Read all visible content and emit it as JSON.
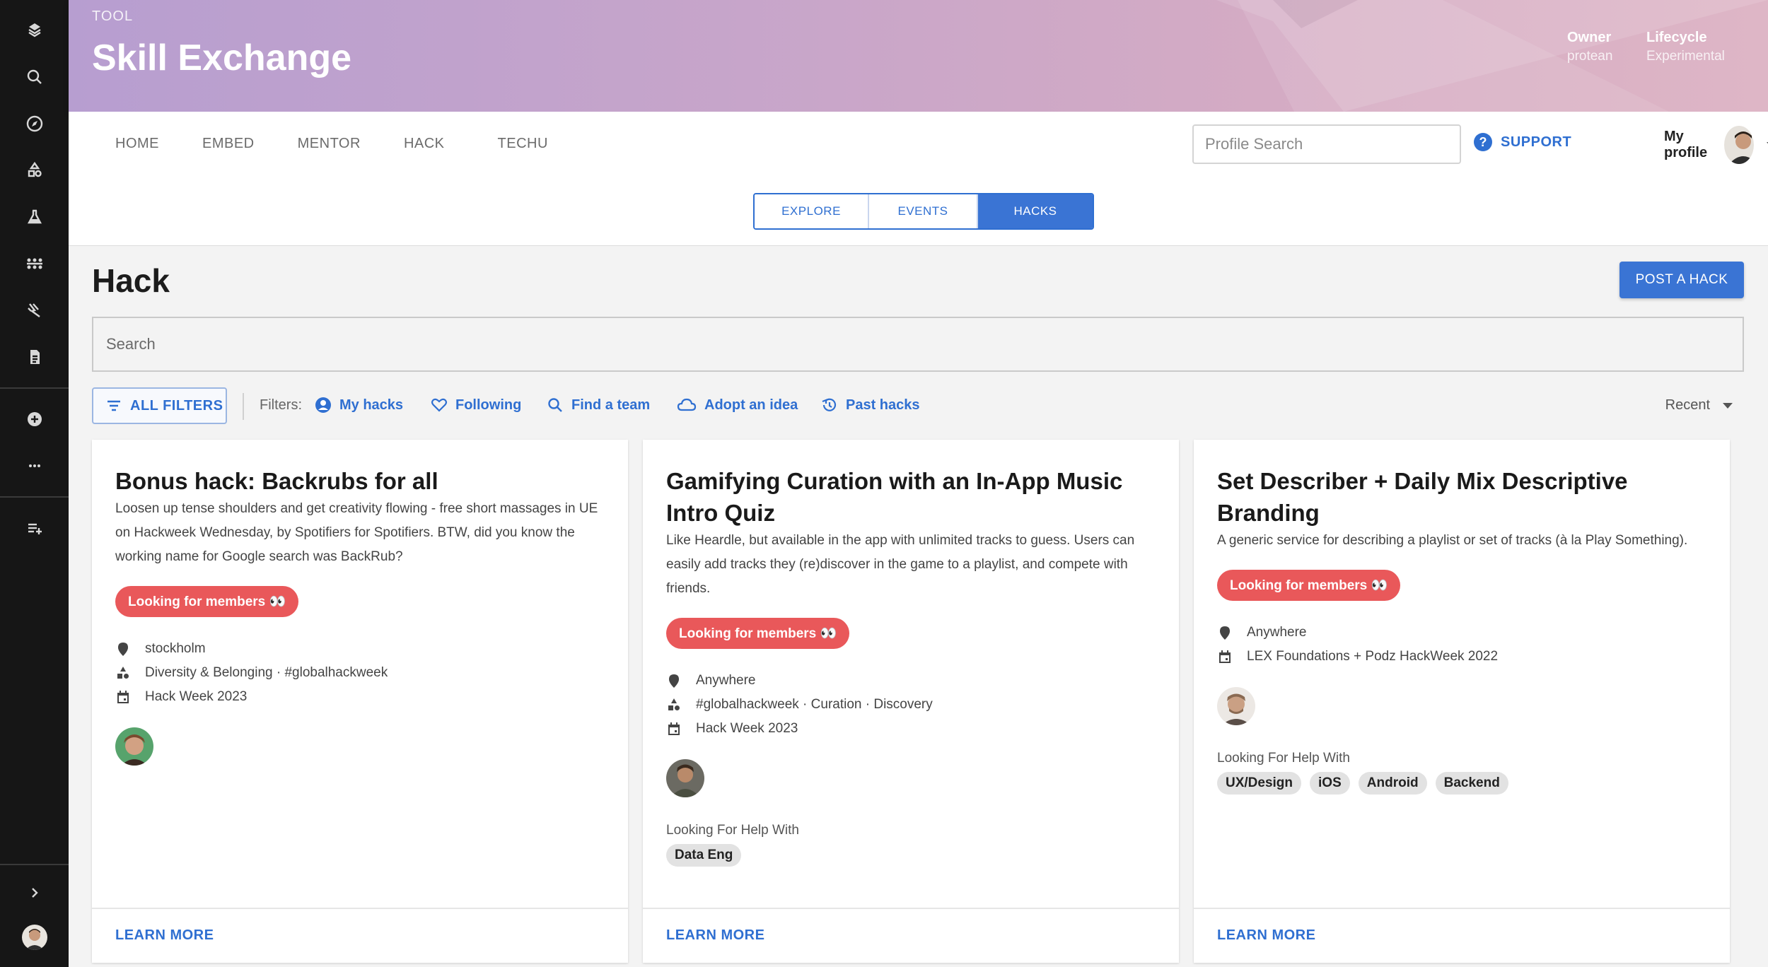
{
  "banner": {
    "kicker": "TOOL",
    "title": "Skill Exchange",
    "owner_label": "Owner",
    "owner_value": "protean",
    "lifecycle_label": "Lifecycle",
    "lifecycle_value": "Experimental"
  },
  "nav": {
    "links": [
      "HOME",
      "EMBED",
      "MENTOR",
      "HACK",
      "TECHU"
    ],
    "profile_search_placeholder": "Profile Search",
    "support_label": "SUPPORT",
    "my_profile_label": "My profile"
  },
  "tabs": [
    "EXPLORE",
    "EVENTS",
    "HACKS"
  ],
  "active_tab": "HACKS",
  "page": {
    "title": "Hack",
    "post_button": "POST A HACK",
    "search_placeholder": "Search"
  },
  "filters": {
    "all_filters_label": "ALL FILTERS",
    "label": "Filters:",
    "chips": [
      "My hacks",
      "Following",
      "Find a team",
      "Adopt an idea",
      "Past hacks"
    ],
    "sort_label": "Recent"
  },
  "cards": [
    {
      "title": "Bonus hack: Backrubs for all",
      "description": "Loosen up tense shoulders and get creativity flowing - free short massages in UE on Hackweek Wednesday, by Spotifiers for Spotifiers. BTW, did you know the working name for Google search was BackRub?",
      "badge": "Looking for members 👀",
      "location": "stockholm",
      "tags": "Diversity & Belonging · #globalhackweek",
      "event": "Hack Week 2023",
      "help_label": "",
      "skills": [],
      "learn_more": "LEARN MORE"
    },
    {
      "title": "Gamifying Curation with an In-App Music Intro Quiz",
      "description": "Like Heardle, but available in the app with unlimited tracks to guess. Users can easily add tracks they (re)discover in the game to a playlist, and compete with friends.",
      "badge": "Looking for members 👀",
      "location": "Anywhere",
      "tags": "#globalhackweek · Curation · Discovery",
      "event": "Hack Week 2023",
      "help_label": "Looking For Help With",
      "skills": [
        "Data Eng"
      ],
      "learn_more": "LEARN MORE"
    },
    {
      "title": "Set Describer + Daily Mix Descriptive Branding",
      "description": "A generic service for describing a playlist or set of tracks (à la Play Something).",
      "badge": "Looking for members 👀",
      "location": "Anywhere",
      "tags": "",
      "event": "LEX Foundations + Podz HackWeek 2022",
      "help_label": "Looking For Help With",
      "skills": [
        "UX/Design",
        "iOS",
        "Android",
        "Backend"
      ],
      "learn_more": "LEARN MORE"
    }
  ],
  "colors": {
    "accent": "#2f6fd1",
    "badge": "#e9585a",
    "sidebar": "#161616"
  }
}
